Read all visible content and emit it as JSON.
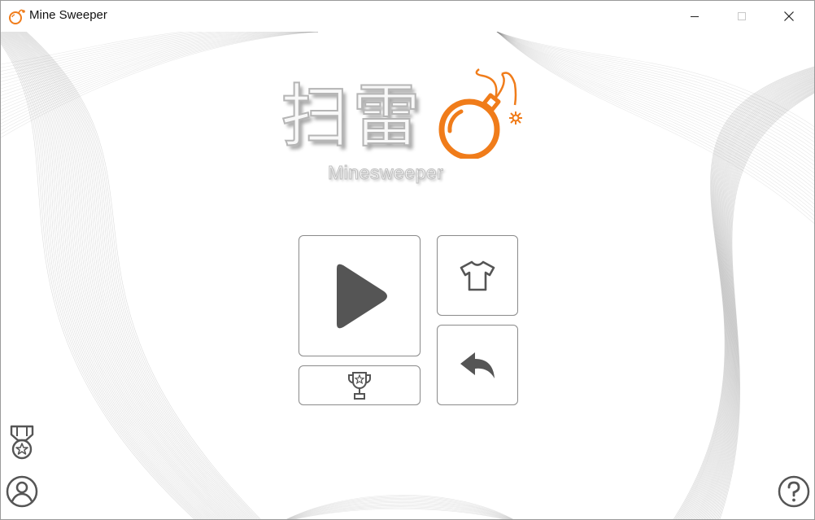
{
  "window": {
    "title": "Mine Sweeper",
    "controls": {
      "minimize": "minimize-icon",
      "maximize": "maximize-icon",
      "close": "close-icon"
    }
  },
  "logo": {
    "chinese_title": "扫雷",
    "english_title": "Minesweeper",
    "accent_color": "#f07c1a"
  },
  "menu": {
    "buttons": [
      {
        "id": "play",
        "icon": "play-icon"
      },
      {
        "id": "leaderboard",
        "icon": "trophy-icon"
      },
      {
        "id": "skins",
        "icon": "tshirt-icon"
      },
      {
        "id": "back",
        "icon": "back-arrow-icon"
      }
    ]
  },
  "corners": {
    "achievements": "medal-icon",
    "profile": "user-icon",
    "help": "help-icon"
  },
  "colors": {
    "icon_gray": "#555555",
    "border_gray": "#8a8a8a",
    "brand_orange": "#f07c1a"
  }
}
